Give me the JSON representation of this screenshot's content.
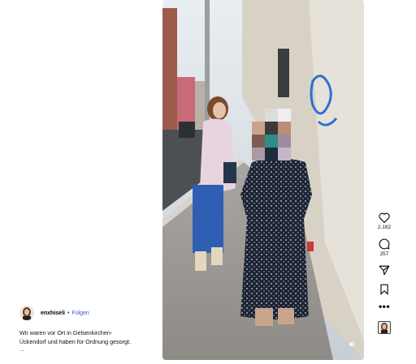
{
  "post": {
    "username": "enxhiseli",
    "separator": "•",
    "follow_label": "Folgen",
    "caption_line1": "Wir waren vor Ort in Gelsenkirchen-",
    "caption_line2": "Ückendorf und haben für Ordnung gesorgt.",
    "caption_more": "..."
  },
  "actions": {
    "likes": "2.182",
    "comments": "257",
    "more_label": "•••"
  },
  "colors": {
    "follow_link": "#3a57e8",
    "background": "#ffffff"
  },
  "icons": [
    "heart-icon",
    "comment-icon",
    "share-icon",
    "bookmark-icon",
    "more-icon",
    "audio-icon"
  ]
}
